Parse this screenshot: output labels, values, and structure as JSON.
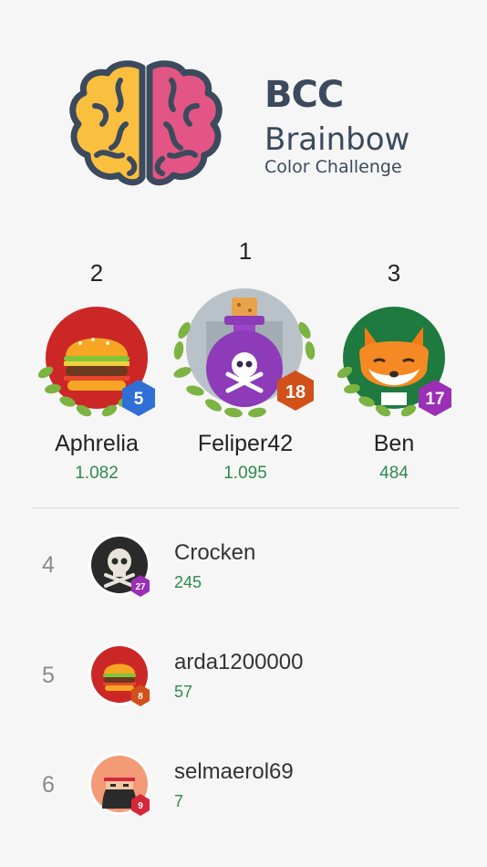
{
  "brand": {
    "abbr": "BCC",
    "name": "Brainbow",
    "subtitle": "Color Challenge"
  },
  "podium": [
    {
      "rank": "2",
      "name": "Aphrelia",
      "score": "1.082",
      "level": "5",
      "avatar_icon": "burger-icon",
      "badge_color": "#2f6fd6"
    },
    {
      "rank": "1",
      "name": "Feliper42",
      "score": "1.095",
      "level": "18",
      "avatar_icon": "potion-skull-icon",
      "badge_color": "#d2501a"
    },
    {
      "rank": "3",
      "name": "Ben",
      "score": "484",
      "level": "17",
      "avatar_icon": "fox-icon",
      "badge_color": "#9b2fb5"
    }
  ],
  "list": [
    {
      "rank": "4",
      "name": "Crocken",
      "score": "245",
      "level": "27",
      "avatar_icon": "skull-icon",
      "badge_color": "#9b2fb5"
    },
    {
      "rank": "5",
      "name": "arda1200000",
      "score": "57",
      "level": "8",
      "avatar_icon": "burger-icon",
      "badge_color": "#d2501a"
    },
    {
      "rank": "6",
      "name": "selmaerol69",
      "score": "7",
      "level": "9",
      "avatar_icon": "ninja-icon",
      "badge_color": "#d4283a"
    }
  ],
  "colors": {
    "score_green": "#2e8b4a",
    "brand_text": "#3b4a5c",
    "brain_left": "#fbbf3f",
    "brain_right": "#e25584"
  }
}
